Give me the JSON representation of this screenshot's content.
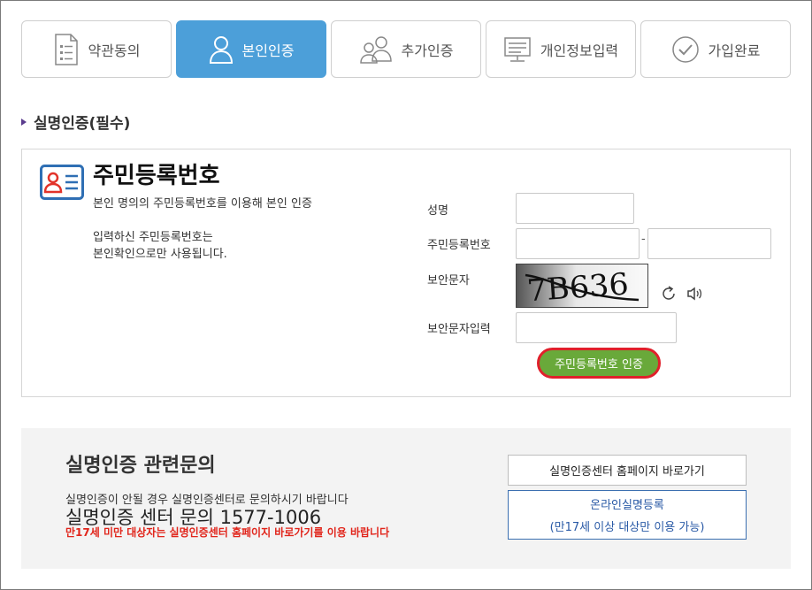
{
  "steps": [
    {
      "label": "약관동의",
      "icon": "document-list-icon",
      "active": false
    },
    {
      "label": "본인인증",
      "icon": "person-icon",
      "active": true
    },
    {
      "label": "추가인증",
      "icon": "two-people-icon",
      "active": false
    },
    {
      "label": "개인정보입력",
      "icon": "monitor-form-icon",
      "active": false
    },
    {
      "label": "가입완료",
      "icon": "check-circle-icon",
      "active": false
    }
  ],
  "section": {
    "title": "실명인증(필수)"
  },
  "verify": {
    "title": "주민등록번호",
    "description": "본인 명의의 주민등록번호를 이용해 본인 인증",
    "notice_line1": "입력하신 주민등록번호는",
    "notice_line2": "본인확인으로만 사용됩니다.",
    "name_label": "성명",
    "rrn_label": "주민등록번호",
    "rrn_separator": "-",
    "captcha_label": "보안문자",
    "captcha_text": "7B636",
    "captcha_input_label": "보안문자입력",
    "submit_label": "주민등록번호 인증"
  },
  "inquiry": {
    "title": "실명인증 관련문의",
    "description": "실명인증이 안될 경우 실명인증센터로 문의하시기 바랍니다",
    "phone_text": "실명인증 센터 문의 1577-1006",
    "warning": "만17세 미만 대상자는 실명인증센터 홈페이지 바로가기를 이용 바랍니다",
    "homepage_button": "실명인증센터 홈페이지 바로가기",
    "online_button_line1": "온라인실명등록",
    "online_button_line2": "(만17세 이상 대상만 이용 가능)"
  },
  "colors": {
    "accent": "#4c9fd9",
    "button_green": "#69a93a",
    "highlight_red": "#e0202b",
    "warning_red": "#e1251b"
  }
}
